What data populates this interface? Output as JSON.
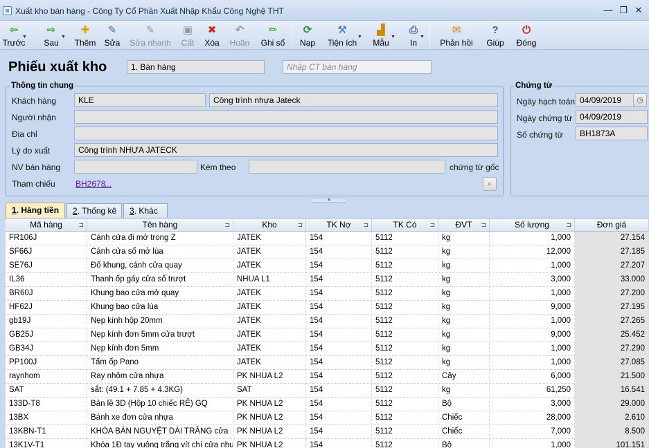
{
  "window": {
    "title": "Xuất kho bán hàng - Công Ty Cổ Phần Xuất Nhập Khẩu Công Nghệ THT",
    "minimize": "—",
    "restore": "❐",
    "close": "✕"
  },
  "toolbar": [
    {
      "label": "Trước",
      "icon": "arrow-left-icon",
      "glyph": "⇦",
      "color": "#2e9a2e",
      "disabled": false,
      "dropdown": true
    },
    {
      "label": "Sau",
      "icon": "arrow-right-icon",
      "glyph": "⇨",
      "color": "#2e9a2e",
      "disabled": false,
      "dropdown": true
    },
    {
      "label": "Thêm",
      "icon": "add-document-icon",
      "glyph": "✚",
      "color": "#d9a400",
      "disabled": false
    },
    {
      "label": "Sửa",
      "icon": "edit-document-icon",
      "glyph": "✎",
      "color": "#3a6fb8",
      "disabled": false
    },
    {
      "label": "Sửa nhanh",
      "icon": "quick-edit-icon",
      "glyph": "✎",
      "color": "#999",
      "disabled": true
    },
    {
      "label": "Cất",
      "icon": "save-icon",
      "glyph": "▣",
      "color": "#999",
      "disabled": true
    },
    {
      "label": "Xóa",
      "icon": "delete-icon",
      "glyph": "✖",
      "color": "#cc2222",
      "disabled": false
    },
    {
      "label": "Hoãn",
      "icon": "undo-icon",
      "glyph": "↶",
      "color": "#999",
      "disabled": true
    },
    {
      "label": "Ghi sổ",
      "icon": "pencil-icon",
      "glyph": "✏",
      "color": "#3a9a2a",
      "disabled": false
    },
    {
      "label": "Nạp",
      "icon": "refresh-icon",
      "glyph": "⟳",
      "color": "#2e8a2e",
      "disabled": false
    },
    {
      "label": "Tiện ích",
      "icon": "tools-icon",
      "glyph": "⚒",
      "color": "#3a6fb8",
      "disabled": false,
      "dropdown": true
    },
    {
      "label": "Mẫu",
      "icon": "chart-template-icon",
      "glyph": "▟",
      "color": "#d08a10",
      "disabled": false,
      "dropdown": true
    },
    {
      "label": "In",
      "icon": "printer-icon",
      "glyph": "⎙",
      "color": "#5a6fb8",
      "disabled": false,
      "dropdown": true
    },
    {
      "label": "Phản hồi",
      "icon": "mail-icon",
      "glyph": "✉",
      "color": "#e07a10",
      "disabled": false
    },
    {
      "label": "Giúp",
      "icon": "help-icon",
      "glyph": "?",
      "color": "#2a62c8",
      "disabled": false
    },
    {
      "label": "Đóng",
      "icon": "power-icon",
      "glyph": "⏻",
      "color": "#d02020",
      "disabled": false
    }
  ],
  "form": {
    "title": "Phiếu xuất kho",
    "type_value": "1. Bán hàng",
    "import_placeholder": "Nhập CT bán hàng"
  },
  "general": {
    "title": "Thông tin chung",
    "customer_label": "Khách hàng",
    "customer_code": "KLE",
    "customer_name": "Công trình nhựa Jateck",
    "receiver_label": "Người nhận",
    "receiver_value": "",
    "address_label": "Địa chỉ",
    "address_value": "",
    "reason_label": "Lý do xuất",
    "reason_value": "Công trình NHỰA JATECK",
    "sales_label": "NV bán hàng",
    "sales_value": "",
    "attach_label": "Kèm theo",
    "attach_value": "",
    "original_label": "chứng từ gốc",
    "ref_label": "Tham chiếu",
    "ref_value": "BH2678",
    "ref_more": "..."
  },
  "voucher": {
    "title": "Chứng từ",
    "posting_label": "Ngày hạch toán",
    "posting_value": "04/09/2019",
    "doc_date_label": "Ngày chứng từ",
    "doc_date_value": "04/09/2019",
    "doc_no_label": "Số chứng từ",
    "doc_no_value": "BH1873A"
  },
  "tabs": [
    {
      "key": "1",
      "label": ". Hàng tiền"
    },
    {
      "key": "2",
      "label": ". Thống kê"
    },
    {
      "key": "3",
      "label": ". Khác"
    }
  ],
  "grid": {
    "columns": [
      "Mã hàng",
      "Tên hàng",
      "Kho",
      "TK Nợ",
      "TK Có",
      "ĐVT",
      "Số lượng",
      "Đơn giá"
    ],
    "rows": [
      [
        "FR106J",
        "Cánh cửa đi mở trong Z",
        "JATEK",
        "154",
        "5112",
        "kg",
        "1,000",
        "27.154"
      ],
      [
        "SF66J",
        "Cánh cửa sổ mở lùa",
        "JATEK",
        "154",
        "5112",
        "kg",
        "12,000",
        "27.185"
      ],
      [
        "SE76J",
        "Đố khung, cánh cửa quay",
        "JATEK",
        "154",
        "5112",
        "kg",
        "1,000",
        "27.207"
      ],
      [
        "IL36",
        "Thanh ốp gáy cửa sổ trượt",
        "NHUA L1",
        "154",
        "5112",
        "kg",
        "3,000",
        "33.000"
      ],
      [
        "BR60J",
        "Khung bao cửa mở quay",
        "JATEK",
        "154",
        "5112",
        "kg",
        "1,000",
        "27.200"
      ],
      [
        "HF62J",
        "Khung bao cửa lùa",
        "JATEK",
        "154",
        "5112",
        "kg",
        "9,000",
        "27.195"
      ],
      [
        "gb19J",
        "Nẹp kính hộp 20mm",
        "JATEK",
        "154",
        "5112",
        "kg",
        "1,000",
        "27.265"
      ],
      [
        "GB25J",
        "Nẹp kính đơn 5mm cửa trượt",
        "JATEK",
        "154",
        "5112",
        "kg",
        "9,000",
        "25.452"
      ],
      [
        "GB34J",
        "Nẹp kính đơn 5mm",
        "JATEK",
        "154",
        "5112",
        "kg",
        "1,000",
        "27.290"
      ],
      [
        "PP100J",
        "Tấm ốp Pano",
        "JATEK",
        "154",
        "5112",
        "kg",
        "1,000",
        "27.085"
      ],
      [
        "raynhom",
        "Ray nhôm cửa nhựa",
        "PK NHUA L2",
        "154",
        "5112",
        "Cây",
        "6,000",
        "21.500"
      ],
      [
        "SAT",
        "sắt: (49.1 + 7.85 + 4.3KG)",
        "SAT",
        "154",
        "5112",
        "kg",
        "61,250",
        "16.541"
      ],
      [
        "133D-T8",
        "Bản lề 3D (Hộp 10 chiếc RẺ) GQ",
        "PK NHUA L2",
        "154",
        "5112",
        "Bộ",
        "3,000",
        "29.000"
      ],
      [
        "13BX",
        "Bánh xe đơn cửa nhựa",
        "PK NHUA L2",
        "154",
        "5112",
        "Chiếc",
        "28,000",
        "2.610"
      ],
      [
        "13KBN-T1",
        "KHÓA BÁN NGUYỆT DÀI TRẮNG cửa",
        "PK NHUA L2",
        "154",
        "5112",
        "Chiếc",
        "7,000",
        "8.500"
      ],
      [
        "13K1V-T1",
        "Khóa 1Đ tay vuông trắng vít chí cửa nhự",
        "PK NHUA L2",
        "154",
        "5112",
        "Bộ",
        "1,000",
        "101.151"
      ]
    ]
  }
}
